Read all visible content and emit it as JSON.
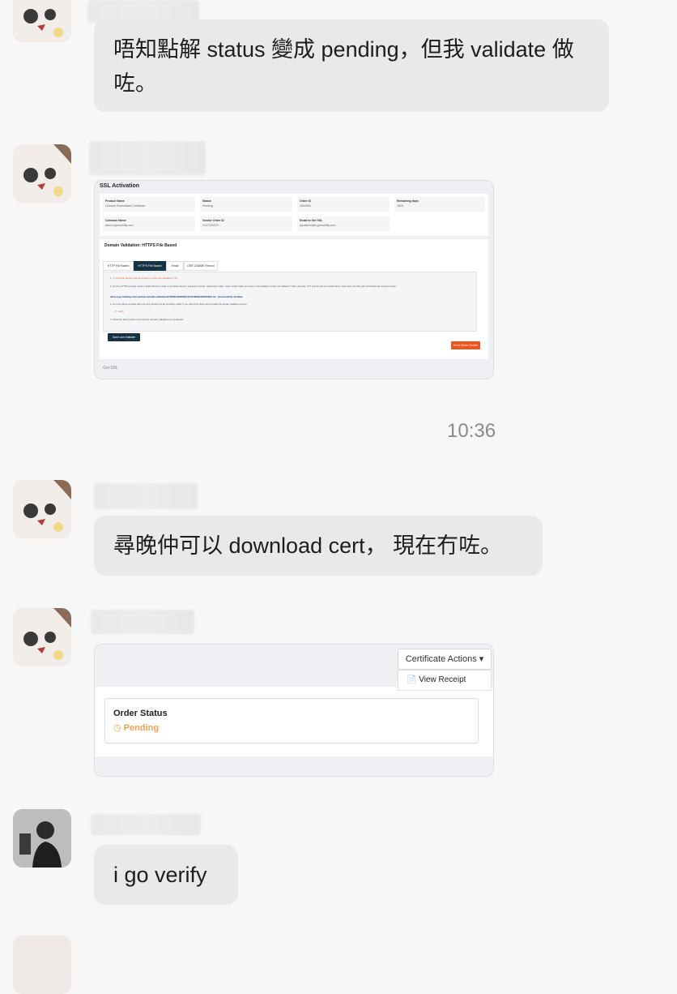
{
  "messages": [
    {
      "text": "唔知點解 status 變成 pending，但我 validate 做咗。"
    },
    {
      "text": "尋晚仲可以 download cert， 現在冇咗。"
    },
    {
      "text": "i go verify"
    }
  ],
  "timestamp": "10:36",
  "screenshot1": {
    "title": "SSL Activation",
    "fields": [
      {
        "label": "Product Name",
        "value": "Comodo Essentialssl Certificate"
      },
      {
        "label": "Status",
        "value": "Pending"
      },
      {
        "label": "Order ID",
        "value": "2064063"
      },
      {
        "label": "Remaining days",
        "value": "1825"
      },
      {
        "label": "Common Name",
        "value": "abcd.a.gomobility.com"
      },
      {
        "label": "Vendor Order ID",
        "value": "2137223373"
      },
      {
        "label": "Email to Get SSL",
        "value": "kyuadmin@a.gomobility.com"
      }
    ],
    "validation_title": "Domain Validation: HTTPS File Based",
    "tabs": [
      "HTTP File Based",
      "HTTPS File Based",
      "Email",
      "DNS CNAME Record"
    ],
    "steps": [
      "1. ⚠ Click file button and download it to visit the Validation TXT",
      "2. On your HTTPS server(s) create a /public directory, create a new folder named \".well-known\" inside \".well-known\" folder, create another folder and name it \"pki-validation\" inside \"pki-validation\" folder, place the .TXT code file that is provided above. Once done, the URL path should look like as shown below:",
      "abcd.a.gomobility.com/.well-known/pki-validation/F563DA3E9FB024C417B29A0D6F53D2.txt - Successfully Verified.",
      "3. Go to the above provided URL and verify whether the file is publicly visible. If yes, click Verify button and complete the domain validation process.",
      "✔ Verify",
      "4. Click the Save button and confirm domain validation is completed."
    ],
    "save_button": "Save and Validate",
    "order_details_button": "Go to Order Details",
    "footer": "Get SSL"
  },
  "screenshot2": {
    "actions_button": "Certificate Actions ▾",
    "view_receipt": "View Receipt",
    "order_status_label": "Order Status",
    "order_status_value": "Pending"
  }
}
